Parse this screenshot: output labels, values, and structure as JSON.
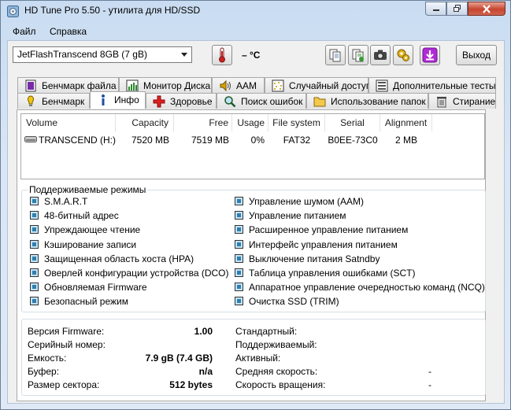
{
  "window": {
    "title": "HD Tune Pro 5.50 - утилита для HD/SSD"
  },
  "menu": [
    {
      "label": "Файл"
    },
    {
      "label": "Справка"
    }
  ],
  "toolbar": {
    "drive": "JetFlashTranscend 8GB (7 gB)",
    "temperature": "– °C",
    "exit_label": "Выход"
  },
  "tabs_row1": [
    {
      "label": "Бенчмарк файла",
      "icon": "file-benchmark-icon"
    },
    {
      "label": "Монитор Диска",
      "icon": "disk-monitor-icon"
    },
    {
      "label": "AAM",
      "icon": "speaker-icon"
    },
    {
      "label": "Случайный доступ",
      "icon": "random-access-icon"
    },
    {
      "label": "Дополнительные тесты",
      "icon": "extra-tests-icon"
    }
  ],
  "tabs_row2": [
    {
      "label": "Бенчмарк",
      "icon": "benchmark-icon"
    },
    {
      "label": "Инфо",
      "icon": "info-icon",
      "active": true
    },
    {
      "label": "Здоровье",
      "icon": "health-icon"
    },
    {
      "label": "Поиск ошибок",
      "icon": "error-scan-icon"
    },
    {
      "label": "Использование папок",
      "icon": "folder-icon"
    },
    {
      "label": "Стирание",
      "icon": "erase-icon"
    }
  ],
  "table": {
    "columns": [
      "Volume",
      "Capacity",
      "Free",
      "Usage",
      "File system",
      "Serial",
      "Alignment"
    ],
    "rows": [
      [
        "TRANSCEND (H:)",
        "7520 MB",
        "7519 MB",
        "0%",
        "FAT32",
        "B0EE-73C0",
        "2 MB"
      ]
    ]
  },
  "features": {
    "title": "Поддерживаемые режимы",
    "left": [
      "S.M.A.R.T",
      "48-битный адрес",
      "Упреждающее чтение",
      "Кэширование записи",
      "Защищенная область хоста (HPA)",
      "Оверлей конфигурации устройства (DCO)",
      "Обновляемая Firmware",
      "Безопасный режим"
    ],
    "right": [
      "Управление шумом (AAM)",
      "Управление питанием",
      "Расширенное управление питанием",
      "Интерфейс управления питанием",
      "Выключение питания Satndby",
      "Таблица управления ошибками (SCT)",
      "Аппаратное управление очередностью команд  (NCQ)",
      "Очистка SSD (TRIM)"
    ]
  },
  "info": {
    "left": [
      {
        "label": "Версия Firmware:",
        "value": "1.00"
      },
      {
        "label": "Серийный номер:",
        "value": ""
      },
      {
        "label": "Емкость:",
        "value": "7.9 gB (7.4 GB)"
      },
      {
        "label": "Буфер:",
        "value": "n/a"
      },
      {
        "label": "Размер сектора:",
        "value": "512 bytes"
      }
    ],
    "right": [
      {
        "label": "Стандартный:",
        "value": ""
      },
      {
        "label": "Поддерживаемый:",
        "value": ""
      },
      {
        "label": "Активный:",
        "value": ""
      },
      {
        "label": "Средняя скорость:",
        "value": "-"
      },
      {
        "label": "Скорость вращения:",
        "value": "-"
      }
    ]
  },
  "colors": {
    "accent": "#2d7fb0",
    "close_button": "#c6452f"
  }
}
